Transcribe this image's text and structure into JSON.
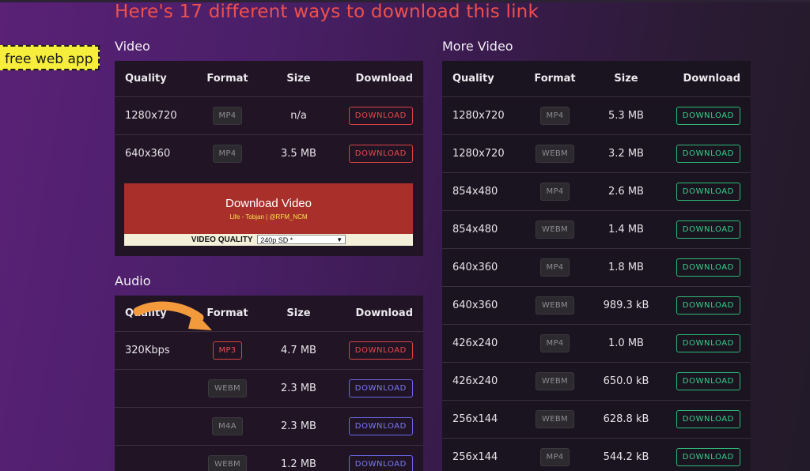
{
  "headline": "Here's 17 different ways to download this link",
  "badge": "free web app",
  "video": {
    "title": "Video",
    "headers": [
      "Quality",
      "Format",
      "Size",
      "Download"
    ],
    "rows": [
      {
        "quality": "1280x720",
        "format": "MP4",
        "size": "n/a",
        "action": "DOWNLOAD"
      },
      {
        "quality": "640x360",
        "format": "MP4",
        "size": "3.5 MB",
        "action": "DOWNLOAD"
      }
    ]
  },
  "promo": {
    "title": "Download Video",
    "subtitle": "Life - Tobjan | @RFM_NCM",
    "quality_label": "VIDEO QUALITY",
    "quality_value": "240p SD *"
  },
  "audio": {
    "title": "Audio",
    "headers": [
      "Quality",
      "Format",
      "Size",
      "Download"
    ],
    "rows": [
      {
        "quality": "320Kbps",
        "format": "MP3",
        "size": "4.7 MB",
        "action": "DOWNLOAD"
      },
      {
        "quality": "",
        "format": "WEBM",
        "size": "2.3 MB",
        "action": "DOWNLOAD"
      },
      {
        "quality": "",
        "format": "M4A",
        "size": "2.3 MB",
        "action": "DOWNLOAD"
      },
      {
        "quality": "",
        "format": "WEBM",
        "size": "1.2 MB",
        "action": "DOWNLOAD"
      }
    ]
  },
  "more_video": {
    "title": "More Video",
    "headers": [
      "Quality",
      "Format",
      "Size",
      "Download"
    ],
    "rows": [
      {
        "quality": "1280x720",
        "format": "MP4",
        "size": "5.3 MB",
        "action": "DOWNLOAD"
      },
      {
        "quality": "1280x720",
        "format": "WEBM",
        "size": "3.2 MB",
        "action": "DOWNLOAD"
      },
      {
        "quality": "854x480",
        "format": "MP4",
        "size": "2.6 MB",
        "action": "DOWNLOAD"
      },
      {
        "quality": "854x480",
        "format": "WEBM",
        "size": "1.4 MB",
        "action": "DOWNLOAD"
      },
      {
        "quality": "640x360",
        "format": "MP4",
        "size": "1.8 MB",
        "action": "DOWNLOAD"
      },
      {
        "quality": "640x360",
        "format": "WEBM",
        "size": "989.3 kB",
        "action": "DOWNLOAD"
      },
      {
        "quality": "426x240",
        "format": "MP4",
        "size": "1.0 MB",
        "action": "DOWNLOAD"
      },
      {
        "quality": "426x240",
        "format": "WEBM",
        "size": "650.0 kB",
        "action": "DOWNLOAD"
      },
      {
        "quality": "256x144",
        "format": "WEBM",
        "size": "628.8 kB",
        "action": "DOWNLOAD"
      },
      {
        "quality": "256x144",
        "format": "MP4",
        "size": "544.2 kB",
        "action": "DOWNLOAD"
      }
    ]
  },
  "colors": {
    "headline": "#f0504a",
    "download_red": "#e84a4a",
    "download_green": "#36d08a",
    "download_blue": "#7b7bf5",
    "promo_background": "#a92f2a",
    "badge_background": "#f7ee3b",
    "annotation_arrow": "#f39a3c"
  },
  "icons": {
    "annotation": "curved-arrow-icon",
    "select": "chevron-down-icon"
  }
}
